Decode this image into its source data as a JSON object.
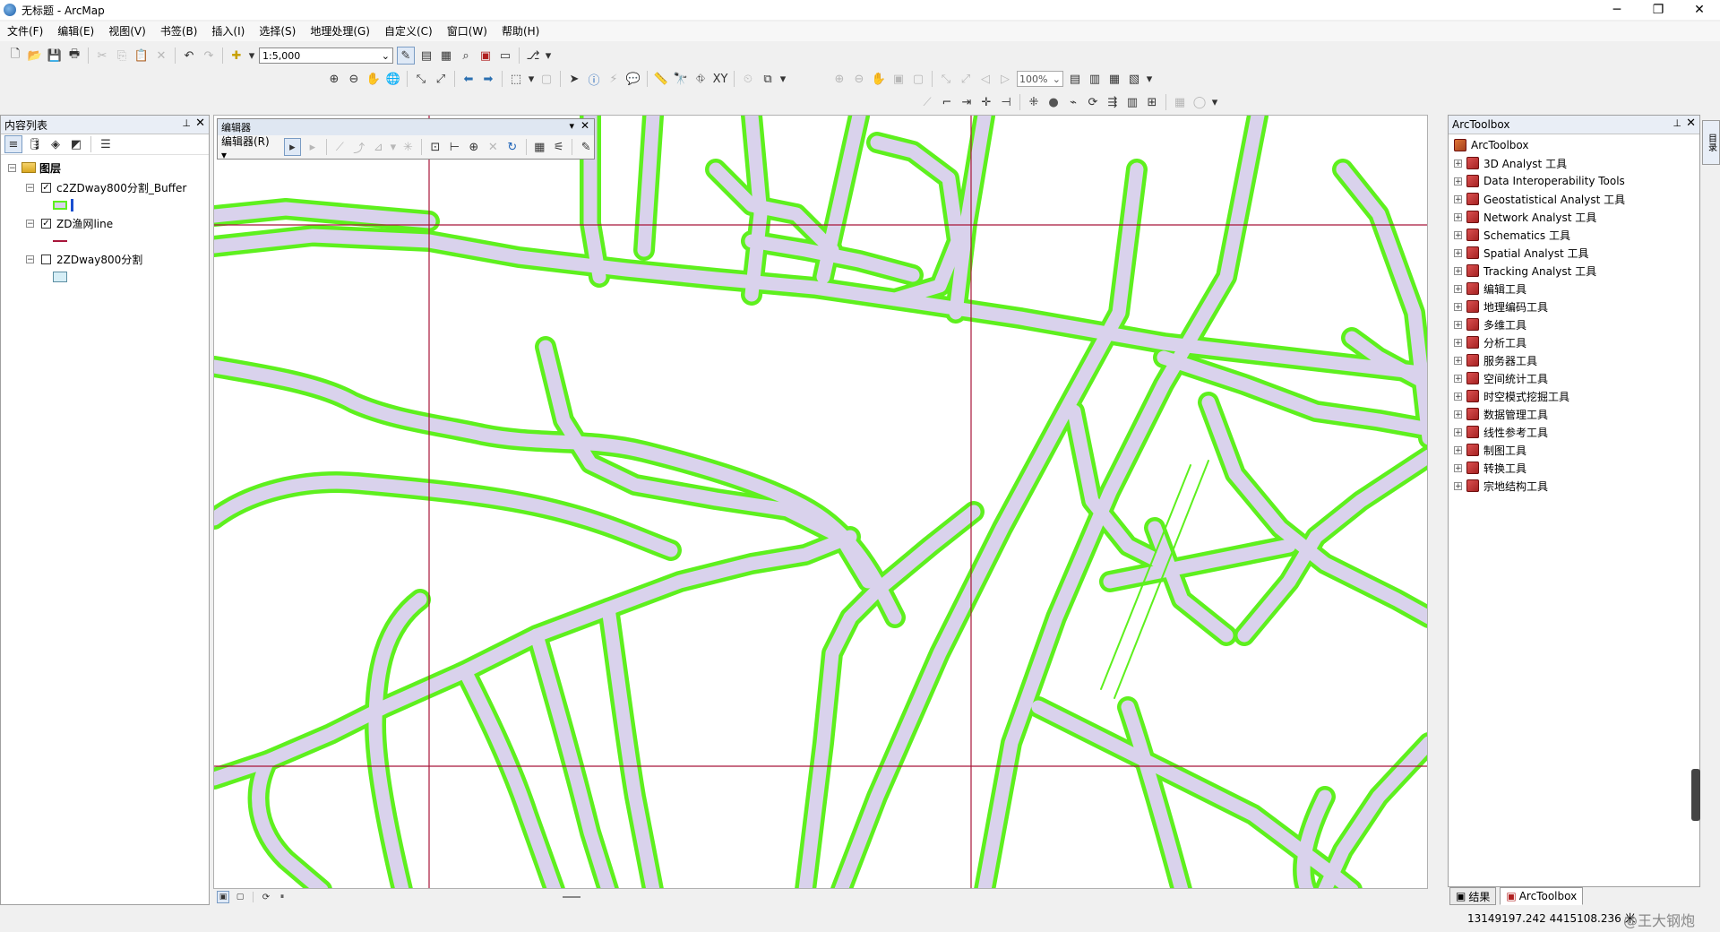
{
  "window": {
    "title": "无标题 - ArcMap"
  },
  "menu": [
    "文件(F)",
    "编辑(E)",
    "视图(V)",
    "书签(B)",
    "插入(I)",
    "选择(S)",
    "地理处理(G)",
    "自定义(C)",
    "窗口(W)",
    "帮助(H)"
  ],
  "toolbar": {
    "scale_value": "1:5,000",
    "zoom_value": "100%"
  },
  "toc": {
    "title": "内容列表",
    "root": "图层",
    "layers": [
      {
        "name": "c2ZDway800分割_Buffer",
        "checked": true
      },
      {
        "name": "ZD渔网line",
        "checked": true
      },
      {
        "name": "2ZDway800分割",
        "checked": false
      }
    ]
  },
  "editor": {
    "title": "编辑器",
    "menu_label": "编辑器(R) ▾"
  },
  "toolbox": {
    "title": "ArcToolbox",
    "root": "ArcToolbox",
    "items": [
      "3D Analyst 工具",
      "Data Interoperability Tools",
      "Geostatistical Analyst 工具",
      "Network Analyst 工具",
      "Schematics 工具",
      "Spatial Analyst 工具",
      "Tracking Analyst 工具",
      "编辑工具",
      "地理编码工具",
      "多维工具",
      "分析工具",
      "服务器工具",
      "空间统计工具",
      "时空模式挖掘工具",
      "数据管理工具",
      "线性参考工具",
      "制图工具",
      "转换工具",
      "宗地结构工具"
    ],
    "tabs": [
      "结果",
      "ArcToolbox"
    ],
    "side_tab": "目录"
  },
  "status": {
    "coordinates": "13149197.242  4415108.236 米",
    "watermark": "@王大钢炮"
  },
  "colors": {
    "buffer_outline": "#5ef01e",
    "buffer_fill": "#d9d2ec",
    "grid_line": "#a8163a"
  }
}
